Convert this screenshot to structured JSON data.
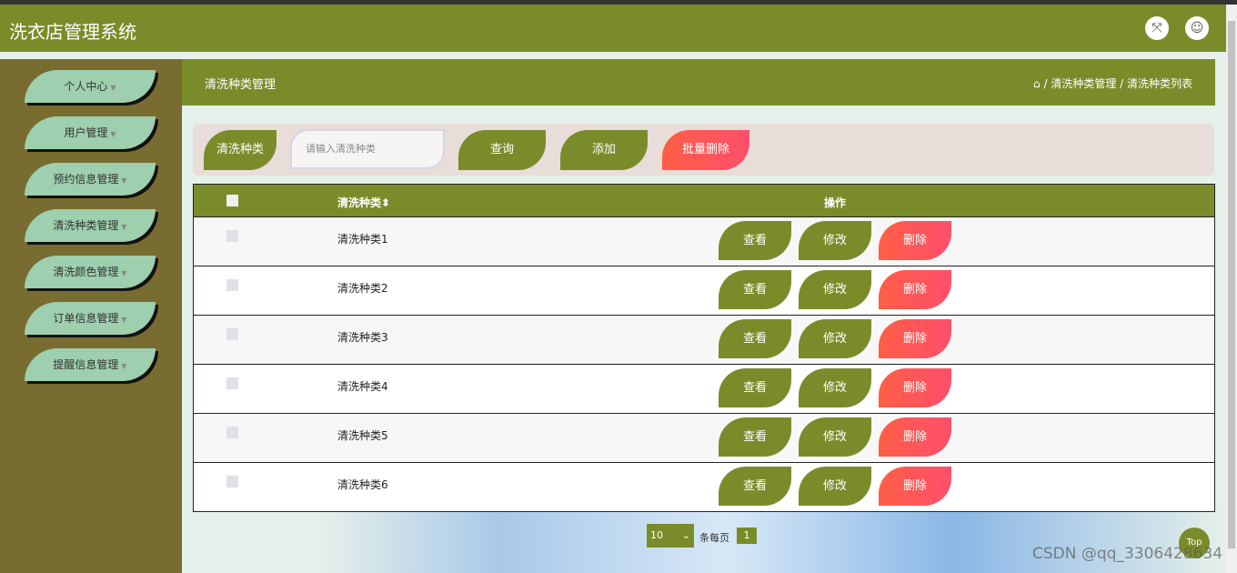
{
  "header": {
    "title": "洗衣店管理系统",
    "icons": [
      "fullscreen-icon",
      "user-icon"
    ]
  },
  "sidebar": {
    "items": [
      {
        "label": "个人中心"
      },
      {
        "label": "用户管理"
      },
      {
        "label": "预约信息管理"
      },
      {
        "label": "清洗种类管理"
      },
      {
        "label": "清洗颜色管理"
      },
      {
        "label": "订单信息管理"
      },
      {
        "label": "提醒信息管理"
      }
    ]
  },
  "page": {
    "title": "清洗种类管理",
    "breadcrumb": "/ 清洗种类管理 / 清洗种类列表"
  },
  "search": {
    "label": "清洗种类",
    "placeholder": "请输入清洗种类",
    "query": "查询",
    "add": "添加",
    "batch_delete": "批量删除"
  },
  "table": {
    "headers": {
      "name": "清洗种类",
      "sort": "⬍",
      "actions": "操作"
    },
    "rows": [
      {
        "name": "清洗种类1"
      },
      {
        "name": "清洗种类2"
      },
      {
        "name": "清洗种类3"
      },
      {
        "name": "清洗种类4"
      },
      {
        "name": "清洗种类5"
      },
      {
        "name": "清洗种类6"
      }
    ],
    "view": "查看",
    "edit": "修改",
    "delete": "删除"
  },
  "pager": {
    "page_size": "10",
    "per_page_label": "条每页",
    "current": "1"
  },
  "top_button": "Top",
  "watermark": "CSDN @qq_3306428634",
  "colors": {
    "primary": "#7a8c2a",
    "danger": "#ff5050",
    "sidebar": "#786c30",
    "nav": "#9ecfae"
  }
}
